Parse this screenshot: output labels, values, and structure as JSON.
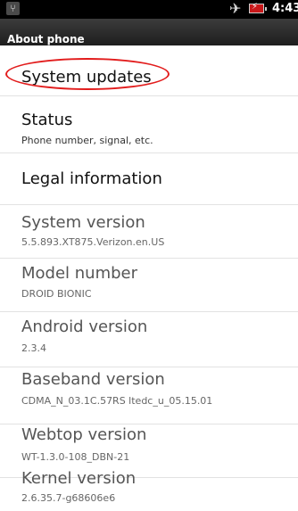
{
  "status_bar": {
    "time": "4:43",
    "icons": [
      "usb-icon",
      "airplane-mode-icon",
      "battery-charging-icon"
    ]
  },
  "title_bar": {
    "title": "About phone"
  },
  "items": [
    {
      "title": "System updates",
      "subtitle": ""
    },
    {
      "title": "Status",
      "subtitle": "Phone number, signal, etc."
    },
    {
      "title": "Legal information",
      "subtitle": ""
    },
    {
      "title": "System version",
      "subtitle": "5.5.893.XT875.Verizon.en.US"
    },
    {
      "title": "Model number",
      "subtitle": "DROID BIONIC"
    },
    {
      "title": "Android version",
      "subtitle": "2.3.4"
    },
    {
      "title": "Baseband version",
      "subtitle": "CDMA_N_03.1C.57RS ltedc_u_05.15.01"
    },
    {
      "title": "Webtop version",
      "subtitle": "WT-1.3.0-108_DBN-21"
    },
    {
      "title": "Kernel version",
      "subtitle": "2.6.35.7-g68606e6"
    }
  ],
  "colors": {
    "status_bar_bg": "#000000",
    "title_bar_bg": "#2a2a2a",
    "annotation_red": "#e21c1c",
    "battery_red": "#c8181a"
  }
}
